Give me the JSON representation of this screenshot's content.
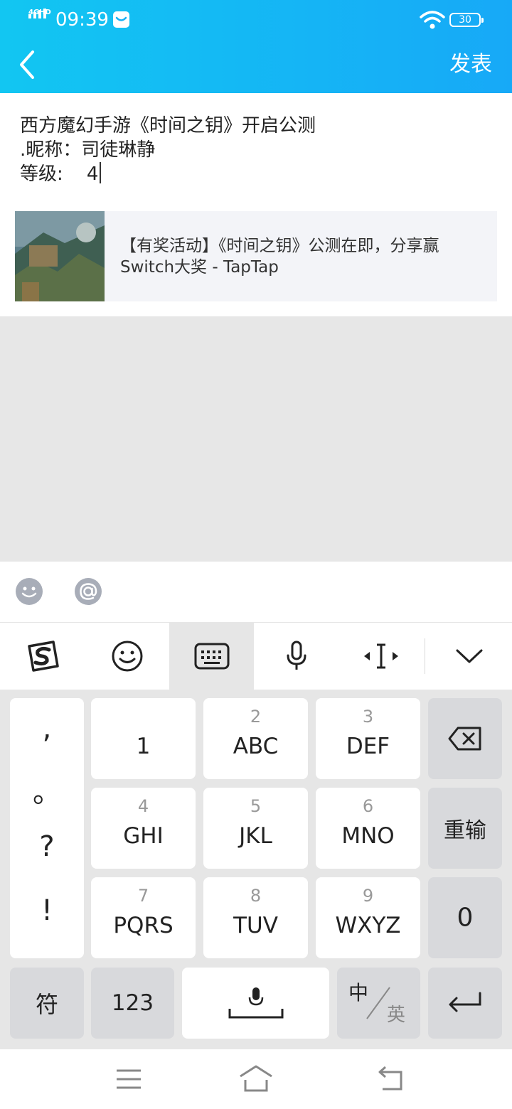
{
  "status_bar": {
    "network": "4GHD",
    "time": "09:39",
    "battery": "30"
  },
  "header": {
    "publish": "发表"
  },
  "post": {
    "lines": [
      "西方魔幻手游《时间之钥》开启公测",
      ".昵称：司徒琳静",
      "等级:    4"
    ]
  },
  "share_card": {
    "text": "【有奖活动】《时间之钥》公测在即，分享赢Switch大奖 - TapTap"
  },
  "keyboard": {
    "punct": [
      ",",
      "。",
      "?",
      "!"
    ],
    "keys": [
      {
        "num": "",
        "letters": "1"
      },
      {
        "num": "2",
        "letters": "ABC"
      },
      {
        "num": "3",
        "letters": "DEF"
      },
      {
        "num": "4",
        "letters": "GHI"
      },
      {
        "num": "5",
        "letters": "JKL"
      },
      {
        "num": "6",
        "letters": "MNO"
      },
      {
        "num": "7",
        "letters": "PQRS"
      },
      {
        "num": "8",
        "letters": "TUV"
      },
      {
        "num": "9",
        "letters": "WXYZ"
      }
    ],
    "reenter": "重输",
    "zero": "0",
    "symbols": "符",
    "numeric": "123",
    "lang_cn": "中",
    "lang_en": "英"
  },
  "colors": {
    "header_start": "#12c6f2",
    "header_end": "#17a9f7",
    "keyboard_bg": "#e6e6e6"
  }
}
